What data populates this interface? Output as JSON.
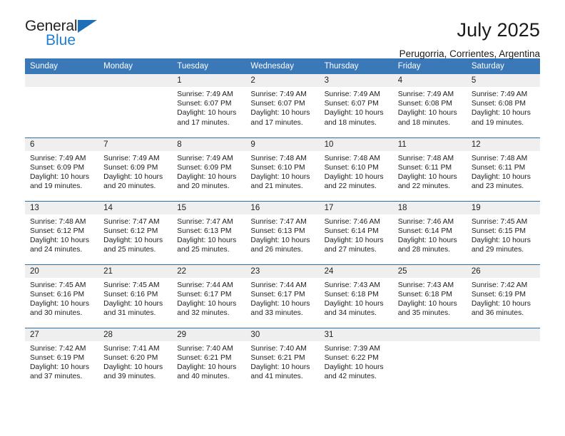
{
  "brand": {
    "name_top": "General",
    "name_bottom": "Blue",
    "triangle_color": "#1f6fb8",
    "bottom_color": "#1f7fd1"
  },
  "header": {
    "title": "July 2025",
    "subtitle": "Perugorria, Corrientes, Argentina"
  },
  "colors": {
    "header_blue": "#3b78b8",
    "row_rule_blue": "#2f6fa8",
    "daynum_band": "#efefef"
  },
  "weekday_headers": [
    "Sunday",
    "Monday",
    "Tuesday",
    "Wednesday",
    "Thursday",
    "Friday",
    "Saturday"
  ],
  "labels": {
    "sunrise_prefix": "Sunrise:",
    "sunset_prefix": "Sunset:",
    "daylight_prefix": "Daylight:"
  },
  "weeks": [
    [
      {
        "day": "",
        "sunrise": "",
        "sunset": "",
        "daylight_a": "",
        "daylight_b": ""
      },
      {
        "day": "",
        "sunrise": "",
        "sunset": "",
        "daylight_a": "",
        "daylight_b": ""
      },
      {
        "day": "1",
        "sunrise": "Sunrise: 7:49 AM",
        "sunset": "Sunset: 6:07 PM",
        "daylight_a": "Daylight: 10 hours",
        "daylight_b": "and 17 minutes."
      },
      {
        "day": "2",
        "sunrise": "Sunrise: 7:49 AM",
        "sunset": "Sunset: 6:07 PM",
        "daylight_a": "Daylight: 10 hours",
        "daylight_b": "and 17 minutes."
      },
      {
        "day": "3",
        "sunrise": "Sunrise: 7:49 AM",
        "sunset": "Sunset: 6:07 PM",
        "daylight_a": "Daylight: 10 hours",
        "daylight_b": "and 18 minutes."
      },
      {
        "day": "4",
        "sunrise": "Sunrise: 7:49 AM",
        "sunset": "Sunset: 6:08 PM",
        "daylight_a": "Daylight: 10 hours",
        "daylight_b": "and 18 minutes."
      },
      {
        "day": "5",
        "sunrise": "Sunrise: 7:49 AM",
        "sunset": "Sunset: 6:08 PM",
        "daylight_a": "Daylight: 10 hours",
        "daylight_b": "and 19 minutes."
      }
    ],
    [
      {
        "day": "6",
        "sunrise": "Sunrise: 7:49 AM",
        "sunset": "Sunset: 6:09 PM",
        "daylight_a": "Daylight: 10 hours",
        "daylight_b": "and 19 minutes."
      },
      {
        "day": "7",
        "sunrise": "Sunrise: 7:49 AM",
        "sunset": "Sunset: 6:09 PM",
        "daylight_a": "Daylight: 10 hours",
        "daylight_b": "and 20 minutes."
      },
      {
        "day": "8",
        "sunrise": "Sunrise: 7:49 AM",
        "sunset": "Sunset: 6:09 PM",
        "daylight_a": "Daylight: 10 hours",
        "daylight_b": "and 20 minutes."
      },
      {
        "day": "9",
        "sunrise": "Sunrise: 7:48 AM",
        "sunset": "Sunset: 6:10 PM",
        "daylight_a": "Daylight: 10 hours",
        "daylight_b": "and 21 minutes."
      },
      {
        "day": "10",
        "sunrise": "Sunrise: 7:48 AM",
        "sunset": "Sunset: 6:10 PM",
        "daylight_a": "Daylight: 10 hours",
        "daylight_b": "and 22 minutes."
      },
      {
        "day": "11",
        "sunrise": "Sunrise: 7:48 AM",
        "sunset": "Sunset: 6:11 PM",
        "daylight_a": "Daylight: 10 hours",
        "daylight_b": "and 22 minutes."
      },
      {
        "day": "12",
        "sunrise": "Sunrise: 7:48 AM",
        "sunset": "Sunset: 6:11 PM",
        "daylight_a": "Daylight: 10 hours",
        "daylight_b": "and 23 minutes."
      }
    ],
    [
      {
        "day": "13",
        "sunrise": "Sunrise: 7:48 AM",
        "sunset": "Sunset: 6:12 PM",
        "daylight_a": "Daylight: 10 hours",
        "daylight_b": "and 24 minutes."
      },
      {
        "day": "14",
        "sunrise": "Sunrise: 7:47 AM",
        "sunset": "Sunset: 6:12 PM",
        "daylight_a": "Daylight: 10 hours",
        "daylight_b": "and 25 minutes."
      },
      {
        "day": "15",
        "sunrise": "Sunrise: 7:47 AM",
        "sunset": "Sunset: 6:13 PM",
        "daylight_a": "Daylight: 10 hours",
        "daylight_b": "and 25 minutes."
      },
      {
        "day": "16",
        "sunrise": "Sunrise: 7:47 AM",
        "sunset": "Sunset: 6:13 PM",
        "daylight_a": "Daylight: 10 hours",
        "daylight_b": "and 26 minutes."
      },
      {
        "day": "17",
        "sunrise": "Sunrise: 7:46 AM",
        "sunset": "Sunset: 6:14 PM",
        "daylight_a": "Daylight: 10 hours",
        "daylight_b": "and 27 minutes."
      },
      {
        "day": "18",
        "sunrise": "Sunrise: 7:46 AM",
        "sunset": "Sunset: 6:14 PM",
        "daylight_a": "Daylight: 10 hours",
        "daylight_b": "and 28 minutes."
      },
      {
        "day": "19",
        "sunrise": "Sunrise: 7:45 AM",
        "sunset": "Sunset: 6:15 PM",
        "daylight_a": "Daylight: 10 hours",
        "daylight_b": "and 29 minutes."
      }
    ],
    [
      {
        "day": "20",
        "sunrise": "Sunrise: 7:45 AM",
        "sunset": "Sunset: 6:16 PM",
        "daylight_a": "Daylight: 10 hours",
        "daylight_b": "and 30 minutes."
      },
      {
        "day": "21",
        "sunrise": "Sunrise: 7:45 AM",
        "sunset": "Sunset: 6:16 PM",
        "daylight_a": "Daylight: 10 hours",
        "daylight_b": "and 31 minutes."
      },
      {
        "day": "22",
        "sunrise": "Sunrise: 7:44 AM",
        "sunset": "Sunset: 6:17 PM",
        "daylight_a": "Daylight: 10 hours",
        "daylight_b": "and 32 minutes."
      },
      {
        "day": "23",
        "sunrise": "Sunrise: 7:44 AM",
        "sunset": "Sunset: 6:17 PM",
        "daylight_a": "Daylight: 10 hours",
        "daylight_b": "and 33 minutes."
      },
      {
        "day": "24",
        "sunrise": "Sunrise: 7:43 AM",
        "sunset": "Sunset: 6:18 PM",
        "daylight_a": "Daylight: 10 hours",
        "daylight_b": "and 34 minutes."
      },
      {
        "day": "25",
        "sunrise": "Sunrise: 7:43 AM",
        "sunset": "Sunset: 6:18 PM",
        "daylight_a": "Daylight: 10 hours",
        "daylight_b": "and 35 minutes."
      },
      {
        "day": "26",
        "sunrise": "Sunrise: 7:42 AM",
        "sunset": "Sunset: 6:19 PM",
        "daylight_a": "Daylight: 10 hours",
        "daylight_b": "and 36 minutes."
      }
    ],
    [
      {
        "day": "27",
        "sunrise": "Sunrise: 7:42 AM",
        "sunset": "Sunset: 6:19 PM",
        "daylight_a": "Daylight: 10 hours",
        "daylight_b": "and 37 minutes."
      },
      {
        "day": "28",
        "sunrise": "Sunrise: 7:41 AM",
        "sunset": "Sunset: 6:20 PM",
        "daylight_a": "Daylight: 10 hours",
        "daylight_b": "and 39 minutes."
      },
      {
        "day": "29",
        "sunrise": "Sunrise: 7:40 AM",
        "sunset": "Sunset: 6:21 PM",
        "daylight_a": "Daylight: 10 hours",
        "daylight_b": "and 40 minutes."
      },
      {
        "day": "30",
        "sunrise": "Sunrise: 7:40 AM",
        "sunset": "Sunset: 6:21 PM",
        "daylight_a": "Daylight: 10 hours",
        "daylight_b": "and 41 minutes."
      },
      {
        "day": "31",
        "sunrise": "Sunrise: 7:39 AM",
        "sunset": "Sunset: 6:22 PM",
        "daylight_a": "Daylight: 10 hours",
        "daylight_b": "and 42 minutes."
      },
      {
        "day": "",
        "sunrise": "",
        "sunset": "",
        "daylight_a": "",
        "daylight_b": ""
      },
      {
        "day": "",
        "sunrise": "",
        "sunset": "",
        "daylight_a": "",
        "daylight_b": ""
      }
    ]
  ]
}
